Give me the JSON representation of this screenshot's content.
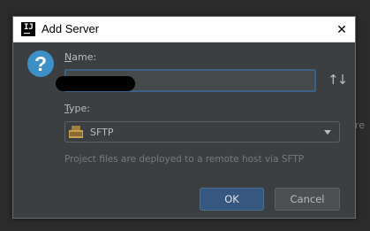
{
  "background": {
    "side_text": "re"
  },
  "dialog": {
    "title": "Add Server",
    "close_glyph": "✕",
    "icon": "question-icon",
    "name": {
      "label_mnemonic": "N",
      "label_rest": "ame:",
      "value": ""
    },
    "sort_glyph": "↑↓",
    "type": {
      "label_mnemonic": "T",
      "label_rest": "ype:",
      "selected": "SFTP"
    },
    "hint": "Project files are deployed to a remote host via SFTP",
    "ok_label": "OK",
    "cancel_label": "Cancel"
  },
  "colors": {
    "accent": "#365880",
    "focus_border": "#3d6185",
    "icon_blue": "#3d8fc8"
  }
}
